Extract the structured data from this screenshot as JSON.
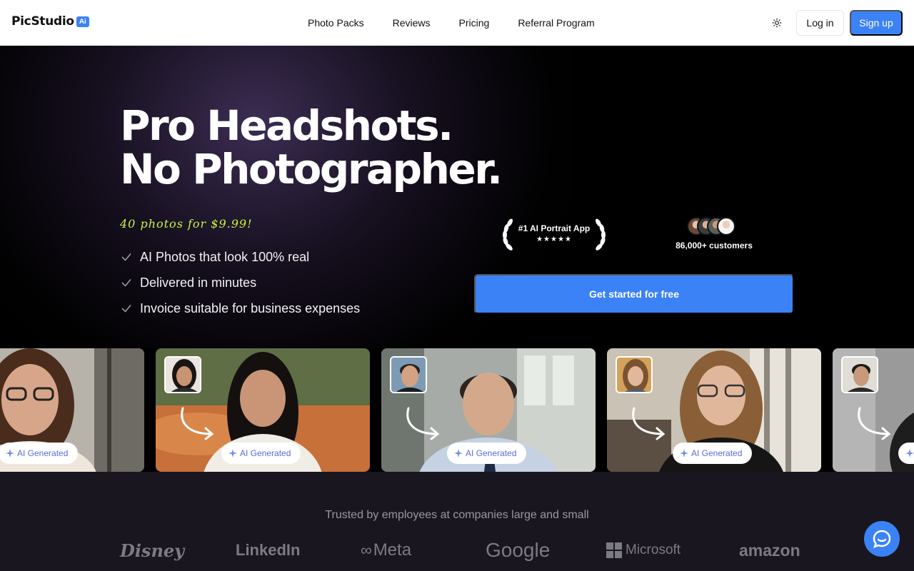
{
  "nav": {
    "logo_text": "PicStudio",
    "logo_badge": "Ai",
    "links": [
      "Photo Packs",
      "Reviews",
      "Pricing",
      "Referral Program"
    ],
    "login": "Log in",
    "signup": "Sign up"
  },
  "hero": {
    "headline_1": "Pro Headshots.",
    "headline_2": "No Photographer.",
    "promo": "40 photos for $9.99!",
    "features": [
      "AI Photos that look 100% real",
      "Delivered in minutes",
      "Invoice suitable for business expenses"
    ],
    "award_title": "#1 AI Portrait App",
    "award_stars": "★★★★★",
    "customers": "86,000+ customers",
    "cta": "Get started for free"
  },
  "gallery": {
    "badge": "AI Generated"
  },
  "trust": {
    "text": "Trusted by employees at companies large and small",
    "brands": [
      "Disney",
      "LinkedIn",
      "Meta",
      "Google",
      "Microsoft",
      "amazon"
    ]
  },
  "colors": {
    "accent": "#3b82f6",
    "promo": "#c8f542",
    "trust_bg": "#1a1620"
  },
  "icons": {
    "theme": "sun-icon",
    "check": "check-icon",
    "chat": "chat-bubble-icon",
    "sparkle": "sparkle-icon",
    "arrow": "curved-arrow-icon"
  }
}
